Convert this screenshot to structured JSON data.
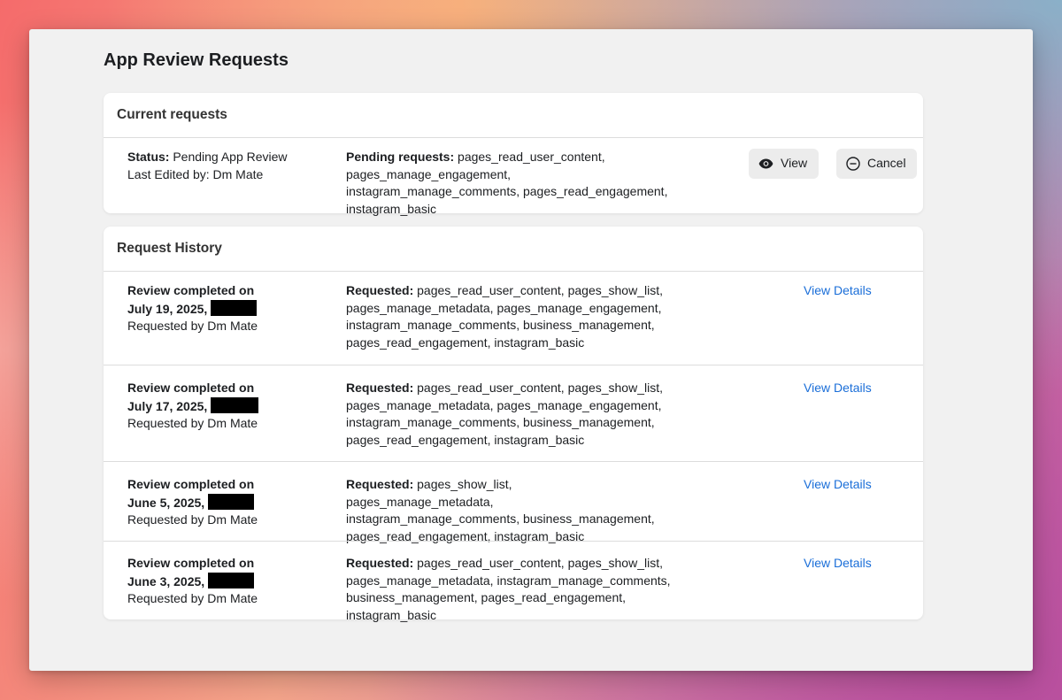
{
  "page": {
    "title": "App Review Requests"
  },
  "current": {
    "header": "Current requests",
    "status_label": "Status:",
    "status_value": " Pending App Review",
    "edited_label": "Last Edited by: Dm Mate",
    "pending_label": "Pending requests:",
    "pending_value": " pages_read_user_content, pages_manage_engagement, instagram_manage_comments, pages_read_engagement, instagram_basic",
    "view_label": "View",
    "cancel_label": "Cancel",
    "view_icon": "eye-icon",
    "cancel_icon": "minus-circle-icon"
  },
  "history": {
    "header": "Request History",
    "link_label": "View Details",
    "link_color": "#1a6ed8",
    "requested_label": "Requested:",
    "items": [
      {
        "line1": "Review completed on",
        "line2": "July 19, 2025,",
        "by": "Requested by Dm Mate",
        "perms": " pages_read_user_content, pages_show_list, pages_manage_metadata, pages_manage_engagement, instagram_manage_comments, business_management, pages_read_engagement, instagram_basic"
      },
      {
        "line1": "Review completed on",
        "line2": "July 17, 2025,",
        "by": "Requested by Dm Mate",
        "perms": " pages_read_user_content, pages_show_list, pages_manage_metadata, pages_manage_engagement, instagram_manage_comments, business_management, pages_read_engagement, instagram_basic"
      },
      {
        "line1": "Review completed on",
        "line2": "June 5, 2025,",
        "by": "Requested by Dm Mate",
        "perms": " pages_show_list, pages_manage_metadata, instagram_manage_comments, business_management, pages_read_engagement, instagram_basic"
      },
      {
        "line1": "Review completed on",
        "line2": "June 3, 2025,",
        "by": "Requested by Dm Mate",
        "perms": " pages_read_user_content, pages_show_list, pages_manage_metadata, instagram_manage_comments, business_management, pages_read_engagement, instagram_basic"
      }
    ]
  }
}
